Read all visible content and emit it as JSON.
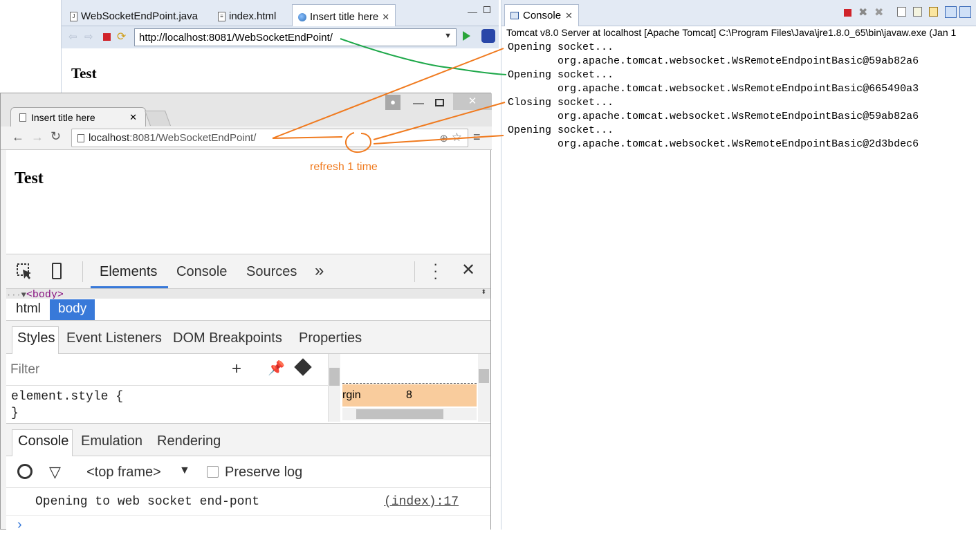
{
  "eclipse_browser": {
    "tabs": [
      {
        "label": "WebSocketEndPoint.java",
        "icon": "java-file-icon"
      },
      {
        "label": "index.html",
        "icon": "html-file-icon"
      },
      {
        "label": "Insert title here",
        "icon": "globe-icon",
        "active": true
      }
    ],
    "url": "http://localhost:8081/WebSocketEndPoint/",
    "page_title": "Test"
  },
  "console_panel": {
    "tab_label": "Console",
    "description": "Tomcat v8.0 Server at localhost [Apache Tomcat] C:\\Program Files\\Java\\jre1.8.0_65\\bin\\javaw.exe (Jan 1",
    "lines": [
      "Opening socket...",
      "        org.apache.tomcat.websocket.WsRemoteEndpointBasic@59ab82a6",
      "Opening socket...",
      "        org.apache.tomcat.websocket.WsRemoteEndpointBasic@665490a3",
      "Closing socket...",
      "        org.apache.tomcat.websocket.WsRemoteEndpointBasic@59ab82a6",
      "Opening socket...",
      "        org.apache.tomcat.websocket.WsRemoteEndpointBasic@2d3bdec6"
    ]
  },
  "chrome": {
    "tab_label": "Insert title here",
    "url_host": "localhost",
    "url_rest": ":8081/WebSocketEndPoint/",
    "page_title": "Test",
    "annotation": "refresh 1 time",
    "devtools": {
      "tabs": [
        "Elements",
        "Console",
        "Sources"
      ],
      "more": "»",
      "crumb": "<body>",
      "path": [
        "html",
        "body"
      ],
      "sub_tabs": [
        "Styles",
        "Event Listeners",
        "DOM Breakpoints",
        "Properties"
      ],
      "filter_placeholder": "Filter",
      "style_rule_open": "element.style {",
      "style_rule_close": "}",
      "box_label": "rgin",
      "box_value": "8",
      "drawer_tabs": [
        "Console",
        "Emulation",
        "Rendering"
      ],
      "frame_select": "<top frame>",
      "preserve_log": "Preserve log",
      "message": "Opening to web socket end-pont",
      "message_source": "(index):17",
      "prompt": "›"
    }
  },
  "colors": {
    "annotation_orange": "#f07a1e",
    "annotation_green": "#1ea84a",
    "selected_chip": "#3879d9",
    "devtools_active_tab": "#3879d9"
  }
}
